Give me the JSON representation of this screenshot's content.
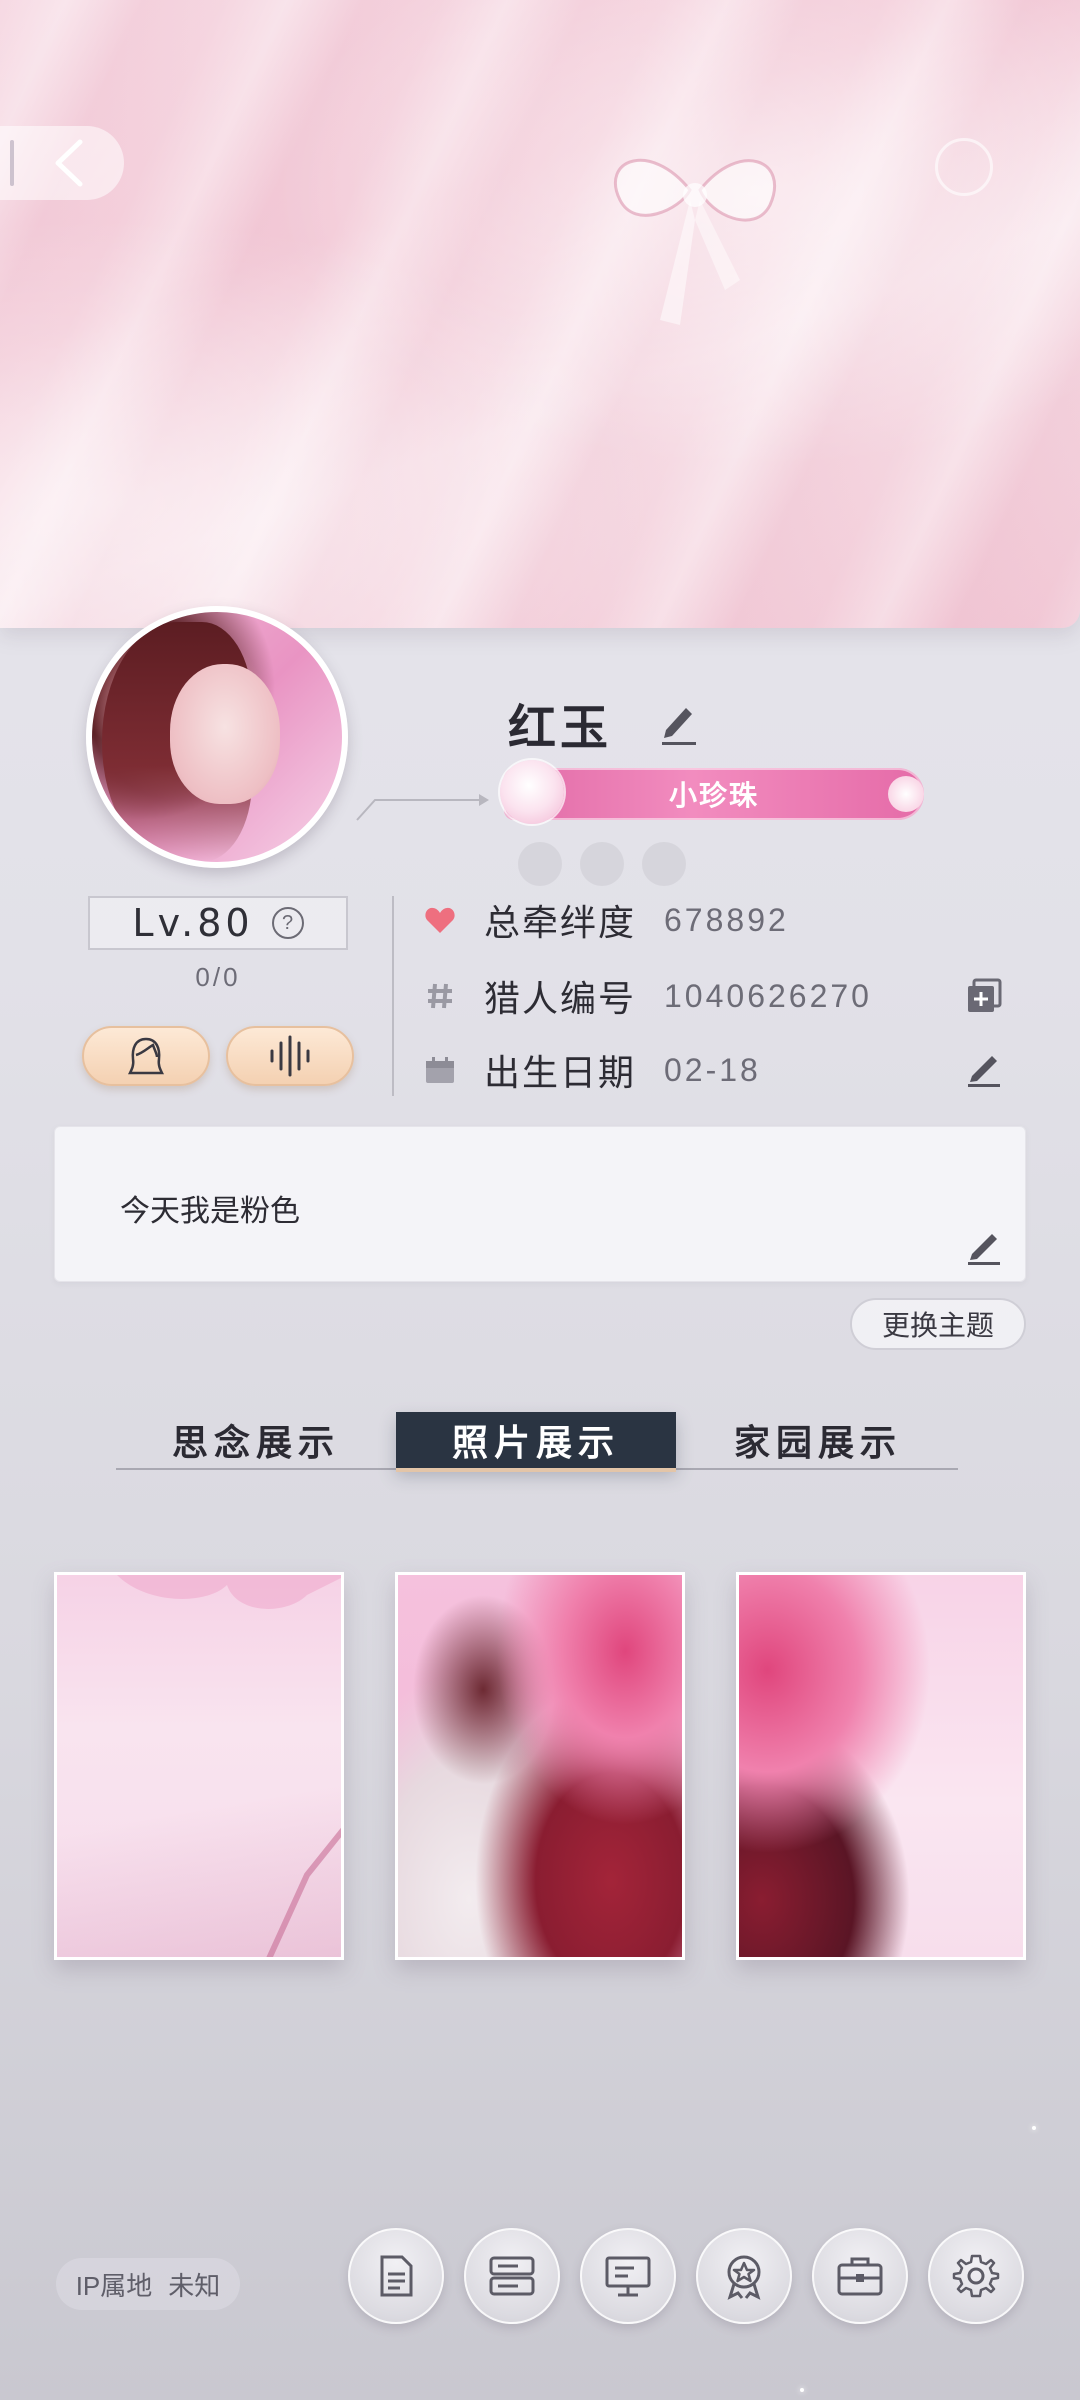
{
  "header": {
    "back_icon": "chevron-left-icon"
  },
  "profile": {
    "name": "红玉",
    "badge_label": "小珍珠",
    "level": "Lv.80",
    "level_help": "?",
    "progress": "0/0"
  },
  "info": {
    "rows": [
      {
        "label": "总牵绊度",
        "value": "678892",
        "icon": "heart-icon"
      },
      {
        "label": "猎人编号",
        "value": "1040626270",
        "icon": "hash-icon",
        "action": "copy-icon"
      },
      {
        "label": "出生日期",
        "value": "02-18",
        "icon": "calendar-icon",
        "action": "edit-icon"
      }
    ]
  },
  "signature": {
    "text": "今天我是粉色"
  },
  "theme_button": "更换主题",
  "tabs": [
    {
      "label": "思念展示",
      "active": false
    },
    {
      "label": "照片展示",
      "active": true
    },
    {
      "label": "家园展示",
      "active": false
    }
  ],
  "footer": {
    "ip_label": "IP属地",
    "ip_value": "未知",
    "buttons": [
      "document-icon",
      "card-list-icon",
      "monitor-icon",
      "medal-icon",
      "briefcase-icon",
      "gear-icon"
    ]
  },
  "colors": {
    "accent_pink": "#e56ba8",
    "tab_active_bg": "#2a3442",
    "heart": "#ee6f7f"
  }
}
